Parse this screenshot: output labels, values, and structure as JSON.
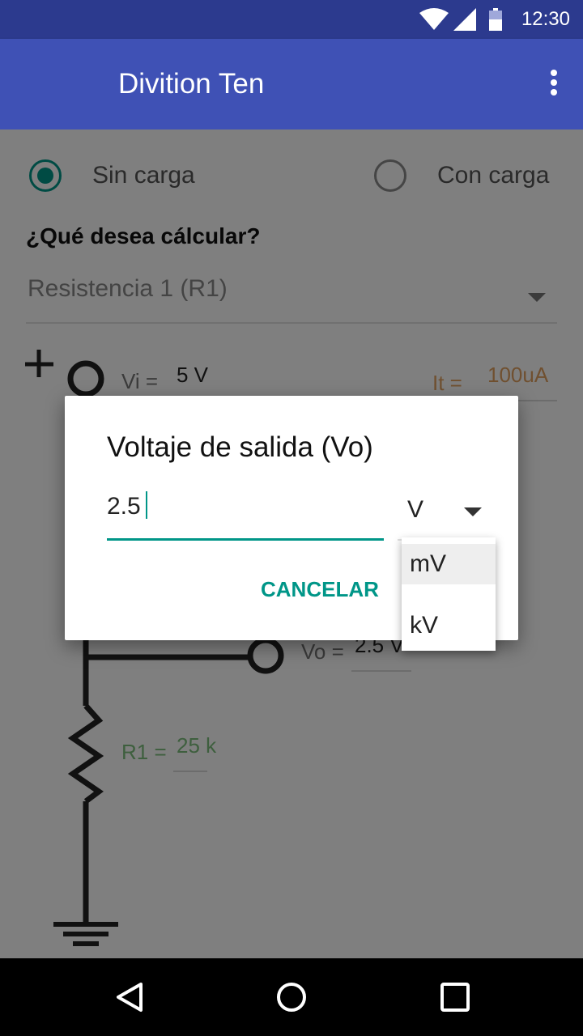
{
  "status_bar": {
    "time": "12:30",
    "icons": [
      "wifi-icon",
      "signal-icon",
      "battery-icon"
    ]
  },
  "app_bar": {
    "title": "Divition Ten",
    "overflow_icon": "more-vert-icon"
  },
  "mode": {
    "option_sin": "Sin carga",
    "option_con": "Con carga",
    "selected": "Sin carga"
  },
  "question": "¿Qué desea cálcular?",
  "calc_select": {
    "value": "Resistencia 1 (R1)"
  },
  "circuit": {
    "plus_sign": "+",
    "vi_label": "Vi =",
    "vi_value": "5 V",
    "it_label": "It =",
    "it_value": "100uA",
    "vo_label": "Vo =",
    "vo_value": "2.5 V",
    "r1_label": "R1 =",
    "r1_value": "25 k"
  },
  "dialog": {
    "title": "Voltaje de salida (Vo)",
    "input_value": "2.5",
    "unit_selected": "V",
    "unit_options": [
      "mV",
      "kV"
    ],
    "cancel_label": "CANCELAR"
  },
  "colors": {
    "primary": "#3f51b5",
    "primary_dark": "#2c3a8e",
    "accent": "#009688",
    "it_color": "#e0a060",
    "r1_color": "#7cbf7c"
  },
  "nav_bar": {
    "buttons": [
      "back-icon",
      "home-icon",
      "recents-icon"
    ]
  }
}
